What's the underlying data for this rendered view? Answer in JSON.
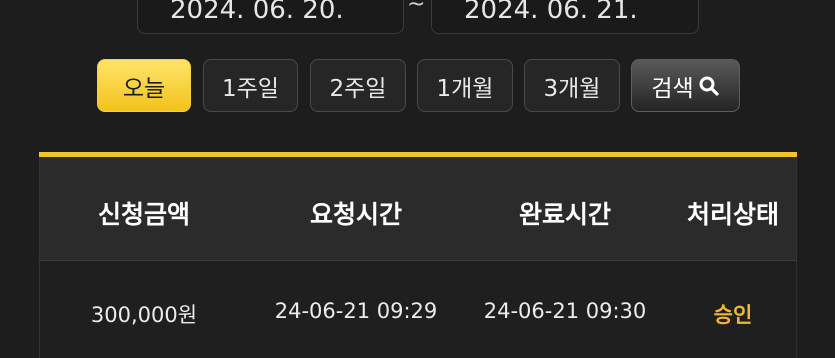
{
  "date_range": {
    "from": "2024. 06. 20.",
    "separator": "~",
    "to": "2024. 06. 21."
  },
  "period_buttons": [
    {
      "label": "오늘",
      "active": true
    },
    {
      "label": "1주일",
      "active": false
    },
    {
      "label": "2주일",
      "active": false
    },
    {
      "label": "1개월",
      "active": false
    },
    {
      "label": "3개월",
      "active": false
    }
  ],
  "search_button": {
    "label": "검색",
    "icon": "search-icon"
  },
  "table": {
    "headers": [
      "신청금액",
      "요청시간",
      "완료시간",
      "처리상태"
    ],
    "rows": [
      {
        "amount": "300,000원",
        "requested": "24-06-21 09:29",
        "completed": "24-06-21 09:30",
        "status": "승인"
      }
    ]
  },
  "colors": {
    "accent": "#f0c42a",
    "status_approved": "#f0b43c",
    "background": "#1d1d1d"
  }
}
